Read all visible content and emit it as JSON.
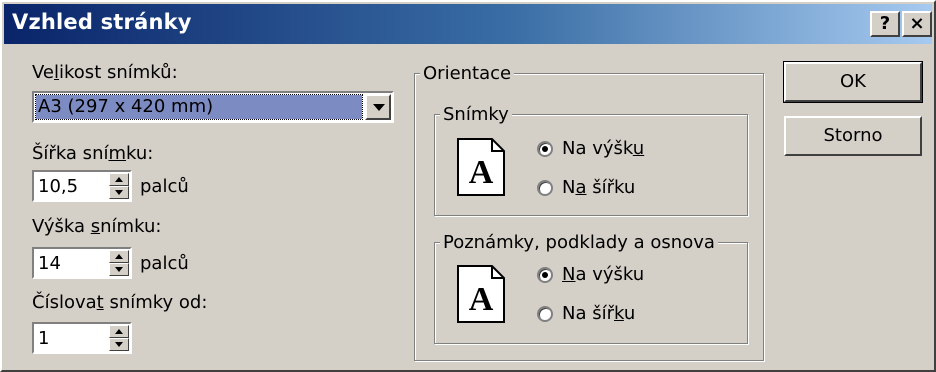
{
  "window": {
    "title": "Vzhled stránky",
    "help": "?",
    "close": "×"
  },
  "size": {
    "label_pre": "Ve",
    "label_u": "l",
    "label_post": "ikost snímků:",
    "value": "A3 (297 x 420 mm)"
  },
  "width": {
    "label_pre": "Šířka sní",
    "label_u": "m",
    "label_post": "ku:",
    "value": "10,5",
    "unit": "palců"
  },
  "height": {
    "label_pre": "Výška ",
    "label_u": "s",
    "label_post": "nímku:",
    "value": "14",
    "unit": "palců"
  },
  "numbering": {
    "label_pre": "Číslova",
    "label_u": "t",
    "label_post": " snímky od:",
    "value": "1"
  },
  "orientation": {
    "title": "Orientace",
    "slides": {
      "title": "Snímky",
      "icon_letter": "A",
      "portrait": {
        "pre": "Na výšk",
        "u": "u",
        "post": "",
        "checked": true
      },
      "landscape": {
        "pre": "N",
        "u": "a",
        "post": " šířku",
        "checked": false
      }
    },
    "notes": {
      "title": "Poznámky, podklady a osnova",
      "icon_letter": "A",
      "portrait": {
        "pre": "",
        "u": "N",
        "post": "a výšku",
        "checked": true
      },
      "landscape": {
        "pre": "Na šíř",
        "u": "k",
        "post": "u",
        "checked": false
      }
    }
  },
  "buttons": {
    "ok": "OK",
    "cancel": "Storno"
  }
}
